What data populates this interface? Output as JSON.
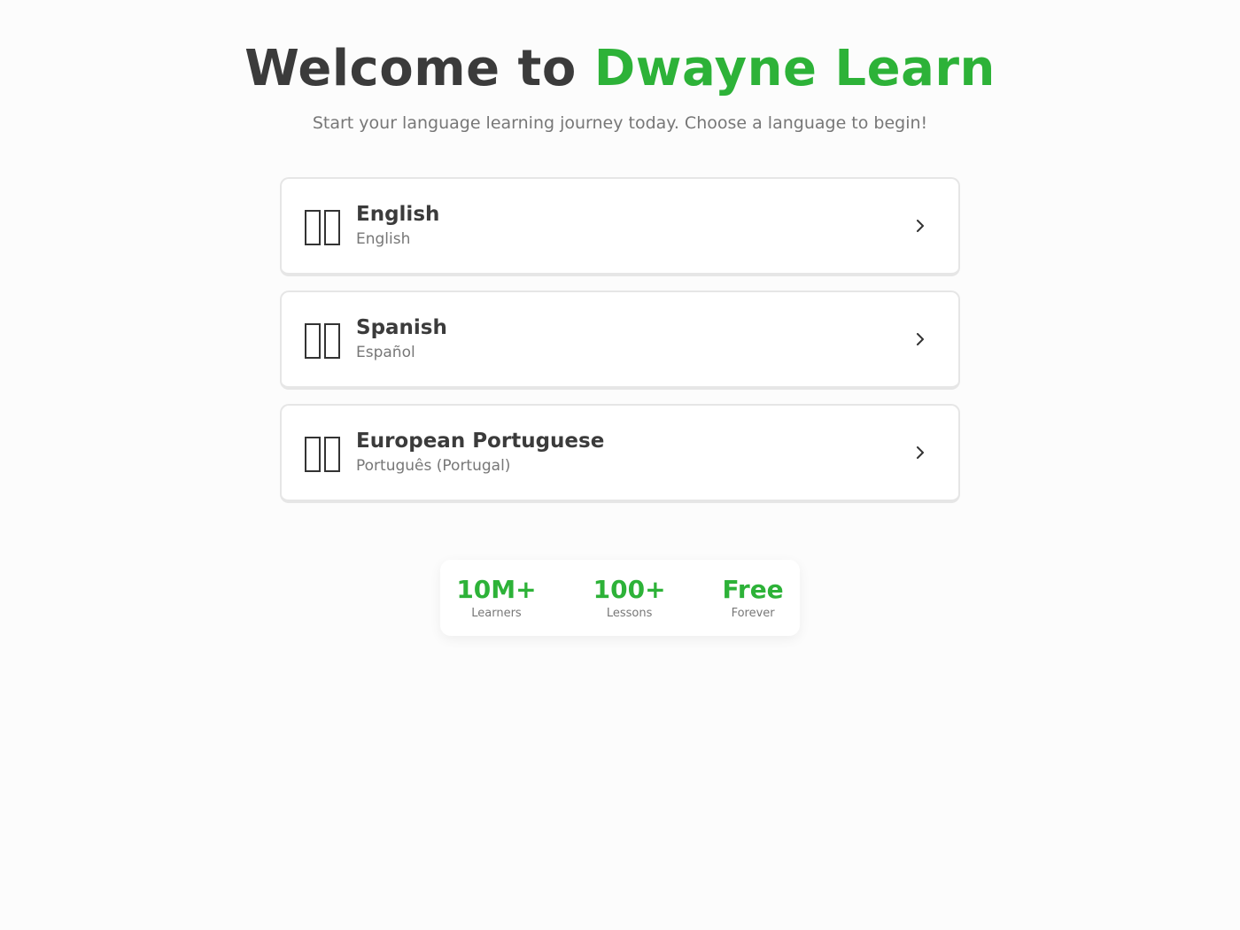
{
  "header": {
    "title_prefix": "Welcome to",
    "title_brand": "Dwayne Learn",
    "subtitle": "Start your language learning journey today. Choose a language to begin!"
  },
  "languages": [
    {
      "name": "English",
      "native": "English",
      "icon": "flag-icon"
    },
    {
      "name": "Spanish",
      "native": "Español",
      "icon": "flag-icon"
    },
    {
      "name": "European Portuguese",
      "native": "Português (Portugal)",
      "icon": "flag-icon"
    }
  ],
  "stats": [
    {
      "value": "10M+",
      "label": "Learners"
    },
    {
      "value": "100+",
      "label": "Lessons"
    },
    {
      "value": "Free",
      "label": "Forever"
    }
  ],
  "colors": {
    "accent": "#2db238",
    "text": "#3b3b3b",
    "muted": "#777777"
  }
}
